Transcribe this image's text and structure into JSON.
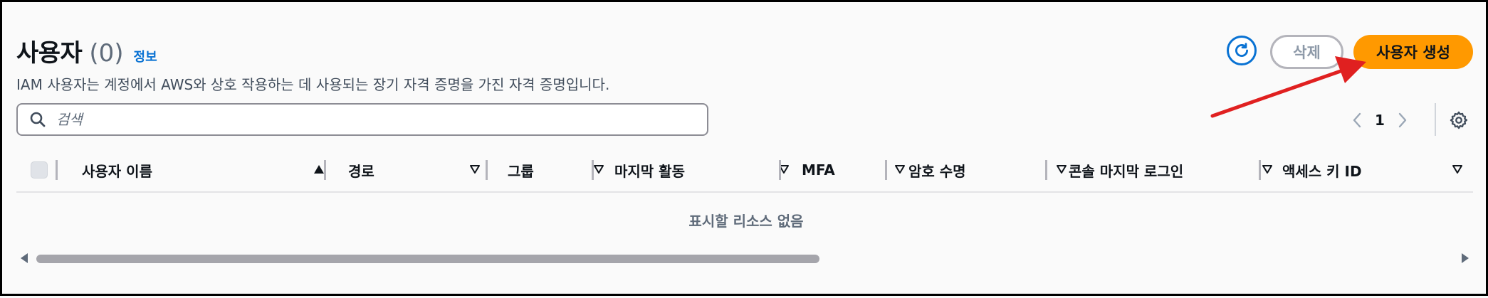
{
  "header": {
    "title": "사용자",
    "count": "(0)",
    "info_link": "정보",
    "description": "IAM 사용자는 계정에서 AWS와 상호 작용하는 데 사용되는 장기 자격 증명을 가진 자격 증명입니다."
  },
  "actions": {
    "refresh_icon": "refresh-icon",
    "delete_label": "삭제",
    "create_label": "사용자 생성"
  },
  "search": {
    "placeholder": "검색",
    "value": ""
  },
  "pagination": {
    "current_page": "1"
  },
  "table": {
    "columns": [
      {
        "label": "사용자 이름",
        "sort": "ascending"
      },
      {
        "label": "경로",
        "sort": "none"
      },
      {
        "label": "그룹",
        "sort": "none"
      },
      {
        "label": "마지막 활동",
        "sort": "none"
      },
      {
        "label": "MFA",
        "sort": "none"
      },
      {
        "label": "암호 수명",
        "sort": "none"
      },
      {
        "label": "콘솔 마지막 로그인",
        "sort": "none"
      },
      {
        "label": "액세스 키 ID",
        "sort": "none"
      }
    ],
    "empty_message": "표시할 리소스 없음"
  },
  "colors": {
    "primary_button": "#ff9900",
    "link": "#0972d3",
    "annotation_arrow": "#e02020"
  }
}
